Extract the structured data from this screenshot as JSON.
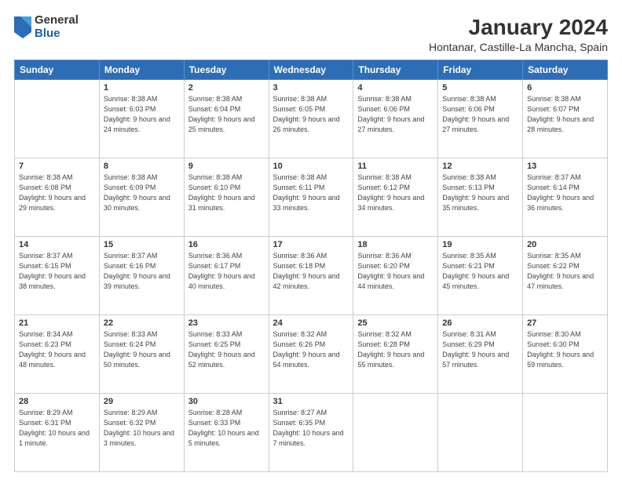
{
  "logo": {
    "general": "General",
    "blue": "Blue"
  },
  "title": "January 2024",
  "subtitle": "Hontanar, Castille-La Mancha, Spain",
  "headers": [
    "Sunday",
    "Monday",
    "Tuesday",
    "Wednesday",
    "Thursday",
    "Friday",
    "Saturday"
  ],
  "weeks": [
    [
      {
        "day": "",
        "sunrise": "",
        "sunset": "",
        "daylight": ""
      },
      {
        "day": "1",
        "sunrise": "Sunrise: 8:38 AM",
        "sunset": "Sunset: 6:03 PM",
        "daylight": "Daylight: 9 hours and 24 minutes."
      },
      {
        "day": "2",
        "sunrise": "Sunrise: 8:38 AM",
        "sunset": "Sunset: 6:04 PM",
        "daylight": "Daylight: 9 hours and 25 minutes."
      },
      {
        "day": "3",
        "sunrise": "Sunrise: 8:38 AM",
        "sunset": "Sunset: 6:05 PM",
        "daylight": "Daylight: 9 hours and 26 minutes."
      },
      {
        "day": "4",
        "sunrise": "Sunrise: 8:38 AM",
        "sunset": "Sunset: 6:06 PM",
        "daylight": "Daylight: 9 hours and 27 minutes."
      },
      {
        "day": "5",
        "sunrise": "Sunrise: 8:38 AM",
        "sunset": "Sunset: 6:06 PM",
        "daylight": "Daylight: 9 hours and 27 minutes."
      },
      {
        "day": "6",
        "sunrise": "Sunrise: 8:38 AM",
        "sunset": "Sunset: 6:07 PM",
        "daylight": "Daylight: 9 hours and 28 minutes."
      }
    ],
    [
      {
        "day": "7",
        "sunrise": "Sunrise: 8:38 AM",
        "sunset": "Sunset: 6:08 PM",
        "daylight": "Daylight: 9 hours and 29 minutes."
      },
      {
        "day": "8",
        "sunrise": "Sunrise: 8:38 AM",
        "sunset": "Sunset: 6:09 PM",
        "daylight": "Daylight: 9 hours and 30 minutes."
      },
      {
        "day": "9",
        "sunrise": "Sunrise: 8:38 AM",
        "sunset": "Sunset: 6:10 PM",
        "daylight": "Daylight: 9 hours and 31 minutes."
      },
      {
        "day": "10",
        "sunrise": "Sunrise: 8:38 AM",
        "sunset": "Sunset: 6:11 PM",
        "daylight": "Daylight: 9 hours and 33 minutes."
      },
      {
        "day": "11",
        "sunrise": "Sunrise: 8:38 AM",
        "sunset": "Sunset: 6:12 PM",
        "daylight": "Daylight: 9 hours and 34 minutes."
      },
      {
        "day": "12",
        "sunrise": "Sunrise: 8:38 AM",
        "sunset": "Sunset: 6:13 PM",
        "daylight": "Daylight: 9 hours and 35 minutes."
      },
      {
        "day": "13",
        "sunrise": "Sunrise: 8:37 AM",
        "sunset": "Sunset: 6:14 PM",
        "daylight": "Daylight: 9 hours and 36 minutes."
      }
    ],
    [
      {
        "day": "14",
        "sunrise": "Sunrise: 8:37 AM",
        "sunset": "Sunset: 6:15 PM",
        "daylight": "Daylight: 9 hours and 38 minutes."
      },
      {
        "day": "15",
        "sunrise": "Sunrise: 8:37 AM",
        "sunset": "Sunset: 6:16 PM",
        "daylight": "Daylight: 9 hours and 39 minutes."
      },
      {
        "day": "16",
        "sunrise": "Sunrise: 8:36 AM",
        "sunset": "Sunset: 6:17 PM",
        "daylight": "Daylight: 9 hours and 40 minutes."
      },
      {
        "day": "17",
        "sunrise": "Sunrise: 8:36 AM",
        "sunset": "Sunset: 6:18 PM",
        "daylight": "Daylight: 9 hours and 42 minutes."
      },
      {
        "day": "18",
        "sunrise": "Sunrise: 8:36 AM",
        "sunset": "Sunset: 6:20 PM",
        "daylight": "Daylight: 9 hours and 44 minutes."
      },
      {
        "day": "19",
        "sunrise": "Sunrise: 8:35 AM",
        "sunset": "Sunset: 6:21 PM",
        "daylight": "Daylight: 9 hours and 45 minutes."
      },
      {
        "day": "20",
        "sunrise": "Sunrise: 8:35 AM",
        "sunset": "Sunset: 6:22 PM",
        "daylight": "Daylight: 9 hours and 47 minutes."
      }
    ],
    [
      {
        "day": "21",
        "sunrise": "Sunrise: 8:34 AM",
        "sunset": "Sunset: 6:23 PM",
        "daylight": "Daylight: 9 hours and 48 minutes."
      },
      {
        "day": "22",
        "sunrise": "Sunrise: 8:33 AM",
        "sunset": "Sunset: 6:24 PM",
        "daylight": "Daylight: 9 hours and 50 minutes."
      },
      {
        "day": "23",
        "sunrise": "Sunrise: 8:33 AM",
        "sunset": "Sunset: 6:25 PM",
        "daylight": "Daylight: 9 hours and 52 minutes."
      },
      {
        "day": "24",
        "sunrise": "Sunrise: 8:32 AM",
        "sunset": "Sunset: 6:26 PM",
        "daylight": "Daylight: 9 hours and 54 minutes."
      },
      {
        "day": "25",
        "sunrise": "Sunrise: 8:32 AM",
        "sunset": "Sunset: 6:28 PM",
        "daylight": "Daylight: 9 hours and 55 minutes."
      },
      {
        "day": "26",
        "sunrise": "Sunrise: 8:31 AM",
        "sunset": "Sunset: 6:29 PM",
        "daylight": "Daylight: 9 hours and 57 minutes."
      },
      {
        "day": "27",
        "sunrise": "Sunrise: 8:30 AM",
        "sunset": "Sunset: 6:30 PM",
        "daylight": "Daylight: 9 hours and 59 minutes."
      }
    ],
    [
      {
        "day": "28",
        "sunrise": "Sunrise: 8:29 AM",
        "sunset": "Sunset: 6:31 PM",
        "daylight": "Daylight: 10 hours and 1 minute."
      },
      {
        "day": "29",
        "sunrise": "Sunrise: 8:29 AM",
        "sunset": "Sunset: 6:32 PM",
        "daylight": "Daylight: 10 hours and 3 minutes."
      },
      {
        "day": "30",
        "sunrise": "Sunrise: 8:28 AM",
        "sunset": "Sunset: 6:33 PM",
        "daylight": "Daylight: 10 hours and 5 minutes."
      },
      {
        "day": "31",
        "sunrise": "Sunrise: 8:27 AM",
        "sunset": "Sunset: 6:35 PM",
        "daylight": "Daylight: 10 hours and 7 minutes."
      },
      {
        "day": "",
        "sunrise": "",
        "sunset": "",
        "daylight": ""
      },
      {
        "day": "",
        "sunrise": "",
        "sunset": "",
        "daylight": ""
      },
      {
        "day": "",
        "sunrise": "",
        "sunset": "",
        "daylight": ""
      }
    ]
  ]
}
